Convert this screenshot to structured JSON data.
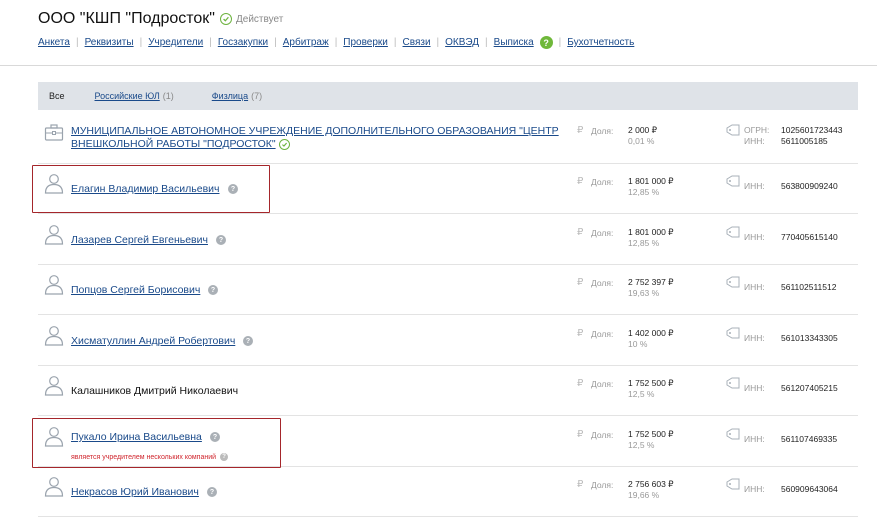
{
  "header": {
    "title": "ООО \"КШП \"Подросток\"",
    "status": "Действует",
    "nav": [
      "Анкета",
      "Реквизиты",
      "Учредители",
      "Госзакупки",
      "Арбитраж",
      "Проверки",
      "Связи",
      "ОКВЭД",
      "Выписка",
      "Бухотчетность"
    ],
    "help_glyph": "?"
  },
  "filters": {
    "all": "Все",
    "ru_entities": "Российские ЮЛ",
    "ru_entities_count": "(1)",
    "individuals": "Физлица",
    "individuals_count": "(7)"
  },
  "labels": {
    "share": "Доля:",
    "ogrn": "ОГРН:",
    "inn": "ИНН:",
    "ruble": "₽",
    "q": "?"
  },
  "founders": [
    {
      "type": "org",
      "name": "МУНИЦИПАЛЬНОЕ АВТОНОМНОЕ УЧРЕЖДЕНИЕ ДОПОЛНИТЕЛЬНОГО ОБРАЗОВАНИЯ \"ЦЕНТР ВНЕШКОЛЬНОЙ РАБОТЫ \"ПОДРОСТОК\"",
      "amount": "2 000 ₽",
      "percent": "0,01 %",
      "ogrn": "1025601723443",
      "inn": "5611005185"
    },
    {
      "type": "person",
      "name": "Елагин Владимир Васильевич",
      "amount": "1 801 000 ₽",
      "percent": "12,85 %",
      "inn": "563800909240",
      "highlighted": true
    },
    {
      "type": "person",
      "name": "Лазарев Сергей Евгеньевич",
      "amount": "1 801 000 ₽",
      "percent": "12,85 %",
      "inn": "770405615140"
    },
    {
      "type": "person",
      "name": "Попцов Сергей Борисович",
      "amount": "2 752 397 ₽",
      "percent": "19,63 %",
      "inn": "561102511512"
    },
    {
      "type": "person",
      "name": "Хисматуллин Андрей Робертович",
      "amount": "1 402 000 ₽",
      "percent": "10 %",
      "inn": "561013343305"
    },
    {
      "type": "person",
      "name": "Калашников Дмитрий Николаевич",
      "amount": "1 752 500 ₽",
      "percent": "12,5 %",
      "inn": "561207405215",
      "plain": true
    },
    {
      "type": "person",
      "name": "Пукало Ирина Васильевна",
      "amount": "1 752 500 ₽",
      "percent": "12,5 %",
      "inn": "561107469335",
      "note": "является учредителем нескольких компаний",
      "highlighted": true
    },
    {
      "type": "person",
      "name": "Некрасов Юрий Иванович",
      "amount": "2 756 603 ₽",
      "percent": "19,66 %",
      "inn": "560909643064"
    }
  ],
  "colors": {
    "link": "#1a4a8a",
    "accent_green": "#6fb83a",
    "highlight": "#a5262b",
    "note_red": "#d0262e",
    "filter_bg": "#dfe3e8"
  }
}
